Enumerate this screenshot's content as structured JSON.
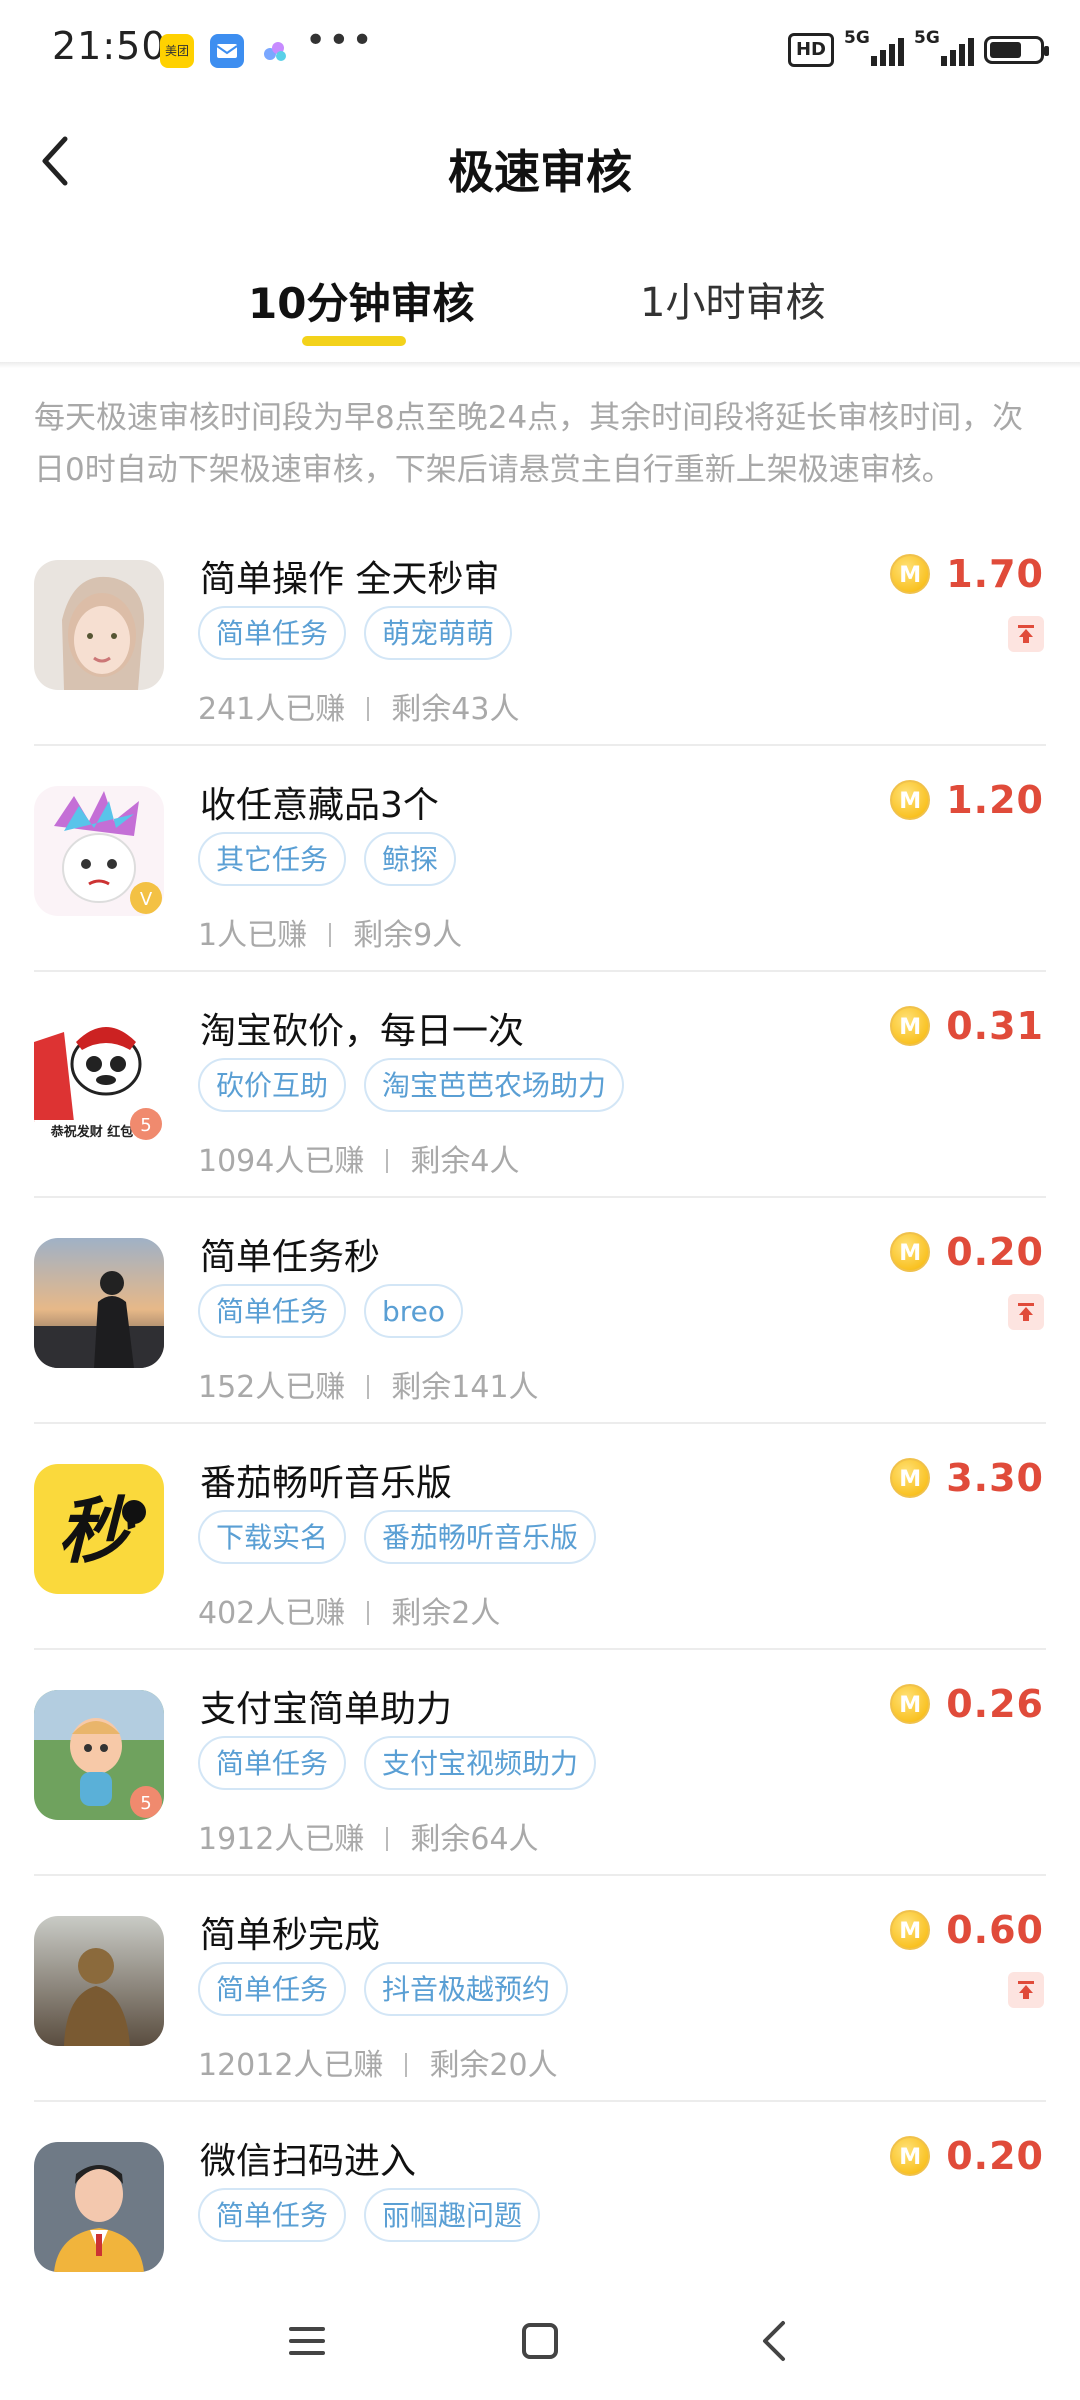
{
  "status_bar": {
    "time": "21:50",
    "apps": [
      "美团"
    ],
    "dots": "•••",
    "hd": "HD",
    "network1": "5G",
    "network2": "5G",
    "battery_level": 0.65
  },
  "header": {
    "title": "极速审核"
  },
  "tabs": [
    {
      "label": "10分钟审核",
      "active": true
    },
    {
      "label": "1小时审核",
      "active": false
    }
  ],
  "notice": "每天极速审核时间段为早8点至晚24点，其余时间段将延长审核时间，次日0时自动下架极速审核，下架后请悬赏主自行重新上架极速审核。",
  "coin_symbol": "M",
  "tasks": [
    {
      "title": "简单操作 全天秒审",
      "tags": [
        "简单任务",
        "萌宠萌萌"
      ],
      "earned": "241人已赚",
      "remaining": "剩余43人",
      "price": "1.70",
      "pinned": true,
      "avatar": "girl-photo"
    },
    {
      "title": "收任意藏品3个",
      "tags": [
        "其它任务",
        "鲸探"
      ],
      "earned": "1人已赚",
      "remaining": "剩余9人",
      "price": "1.20",
      "pinned": false,
      "avatar": "cartoon-avatar"
    },
    {
      "title": "淘宝砍价，每日一次",
      "tags": [
        "砍价互助",
        "淘宝芭芭农场助力"
      ],
      "earned": "1094人已赚",
      "remaining": "剩余4人",
      "price": "0.31",
      "pinned": false,
      "avatar": "panda-meme",
      "avatar_text": "恭祝发财 红包"
    },
    {
      "title": "简单任务秒",
      "tags": [
        "简单任务",
        "breo"
      ],
      "earned": "152人已赚",
      "remaining": "剩余141人",
      "price": "0.20",
      "pinned": true,
      "avatar": "sunset-photo"
    },
    {
      "title": "番茄畅听音乐版",
      "tags": [
        "下载实名",
        "番茄畅听音乐版"
      ],
      "earned": "402人已赚",
      "remaining": "剩余2人",
      "price": "3.30",
      "pinned": false,
      "avatar": "miao-logo",
      "avatar_text": "秒"
    },
    {
      "title": "支付宝简单助力",
      "tags": [
        "简单任务",
        "支付宝视频助力"
      ],
      "earned": "1912人已赚",
      "remaining": "剩余64人",
      "price": "0.26",
      "pinned": false,
      "avatar": "baby-cartoon"
    },
    {
      "title": "简单秒完成",
      "tags": [
        "简单任务",
        "抖音极越预约"
      ],
      "earned": "12012人已赚",
      "remaining": "剩余20人",
      "price": "0.60",
      "pinned": true,
      "avatar": "buddha-photo"
    },
    {
      "title": "微信扫码进入",
      "tags": [
        "简单任务",
        "丽帼趣问题"
      ],
      "earned": "",
      "remaining": "",
      "price": "0.20",
      "pinned": false,
      "avatar": "man-suit"
    }
  ],
  "colors": {
    "accent_underline": "#f3d21b",
    "price_red": "#e04b3a",
    "tag_blue": "#5a9fd4"
  }
}
